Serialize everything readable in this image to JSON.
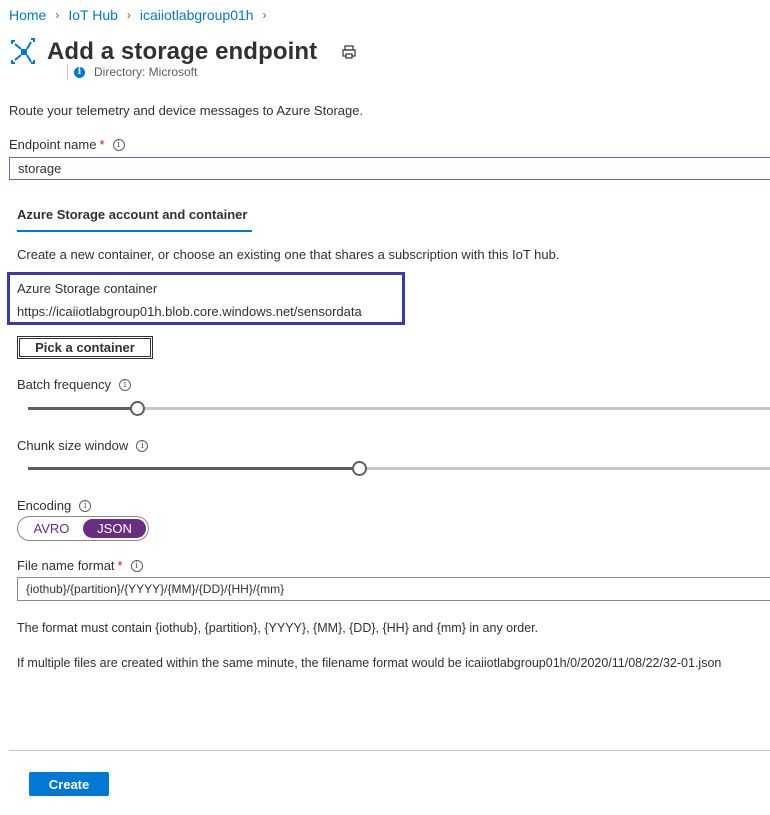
{
  "breadcrumb": [
    {
      "label": "Home"
    },
    {
      "label": "IoT Hub"
    },
    {
      "label": "icaiiotlabgroup01h"
    }
  ],
  "header": {
    "title": "Add a storage endpoint",
    "directory": "Directory: Microsoft"
  },
  "intro": "Route your telemetry and device messages to Azure Storage.",
  "endpoint": {
    "label": "Endpoint name",
    "required_mark": "*",
    "value": "storage"
  },
  "section": {
    "tab": "Azure Storage account and container",
    "description": "Create a new container, or choose an existing one that shares a subscription with this IoT hub."
  },
  "container": {
    "label": "Azure Storage container",
    "url": "https://icaiiotlabgroup01h.blob.core.windows.net/sensordata",
    "pick_button": "Pick a container"
  },
  "batch_frequency": {
    "label": "Batch frequency",
    "level": 0.15
  },
  "chunk_size": {
    "label": "Chunk size window",
    "level": 0.45
  },
  "encoding": {
    "label": "Encoding",
    "options": [
      "AVRO",
      "JSON"
    ],
    "selected": "JSON"
  },
  "file_name": {
    "label": "File name format",
    "required_mark": "*",
    "value": "{iothub}/{partition}/{YYYY}/{MM}/{DD}/{HH}/{mm}"
  },
  "notes": {
    "format_rule": "The format must contain {iothub}, {partition}, {YYYY}, {MM}, {DD}, {HH} and {mm} in any order.",
    "example": "If multiple files are created within the same minute, the filename format would be icaiiotlabgroup01h/0/2020/11/08/22/32-01.json"
  },
  "footer": {
    "create_label": "Create"
  },
  "colors": {
    "accent": "#0078d4",
    "toggle": "#6b2d7f",
    "highlight_box": "#3b39a8",
    "required": "#a4262c"
  },
  "icons": [
    "chevron-right-icon",
    "iot-hub-icon",
    "print-icon",
    "info-icon"
  ]
}
